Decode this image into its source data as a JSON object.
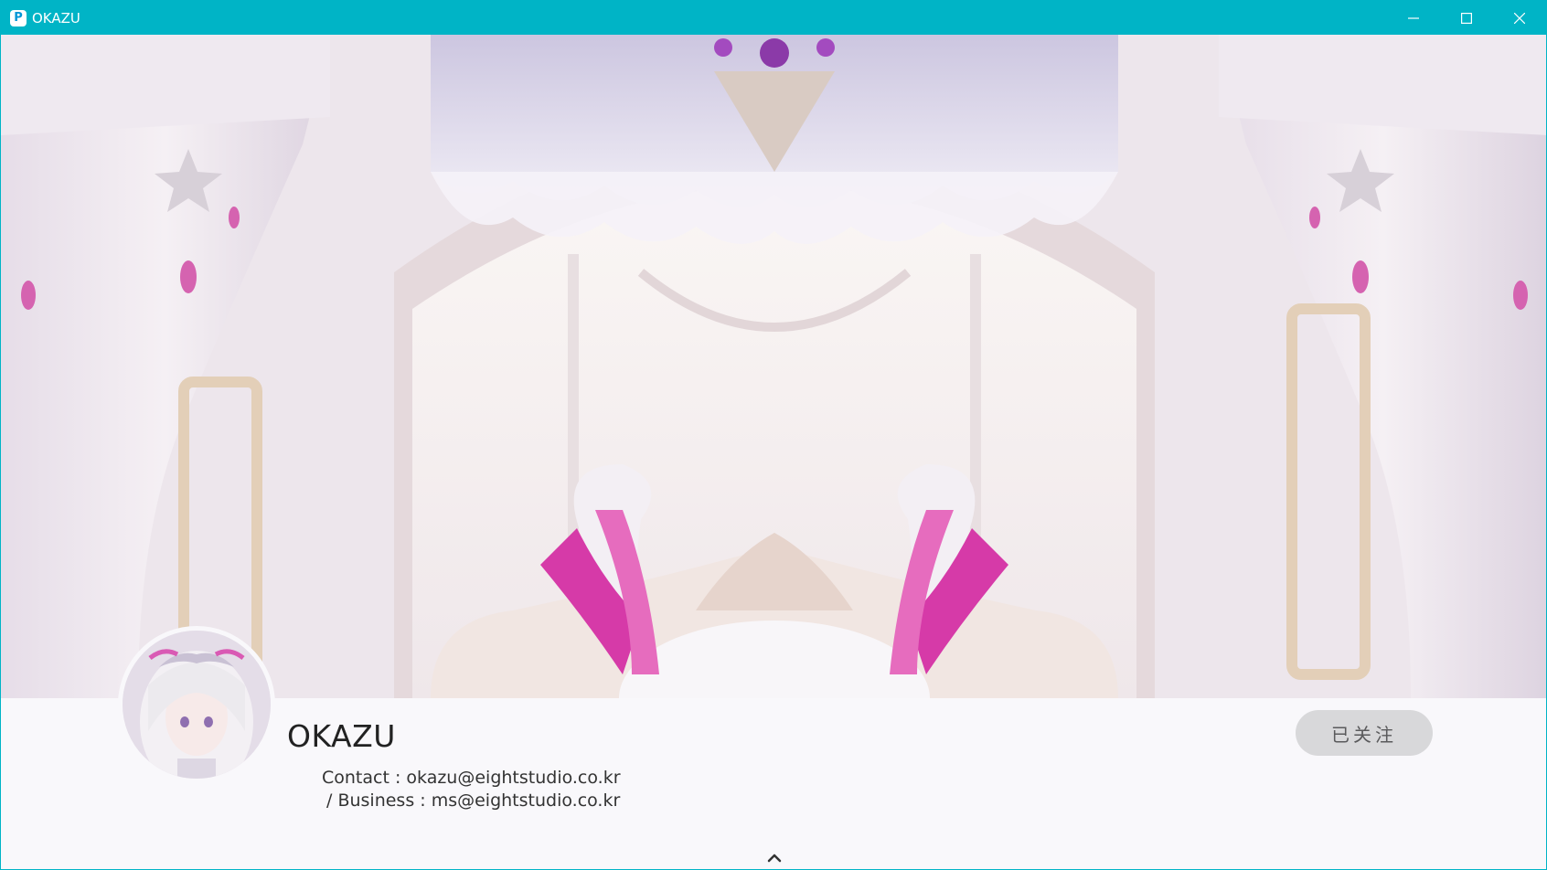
{
  "window": {
    "app_icon_letter": "P",
    "title": "OKAZU",
    "controls": [
      "minimize-icon",
      "maximize-icon",
      "close-icon"
    ],
    "titlebar_color": "#00b4c6"
  },
  "banner": {
    "description_icon": "cover-artwork"
  },
  "profile": {
    "name": "OKAZU",
    "bio_line1": "Contact : okazu@eightstudio.co.kr",
    "bio_line2": "/ Business : ms@eightstudio.co.kr",
    "follow_label": "已关注",
    "follow_state": "following",
    "follow_bg": "#d8d8da"
  },
  "collapse_icon": "chevron-up-icon"
}
